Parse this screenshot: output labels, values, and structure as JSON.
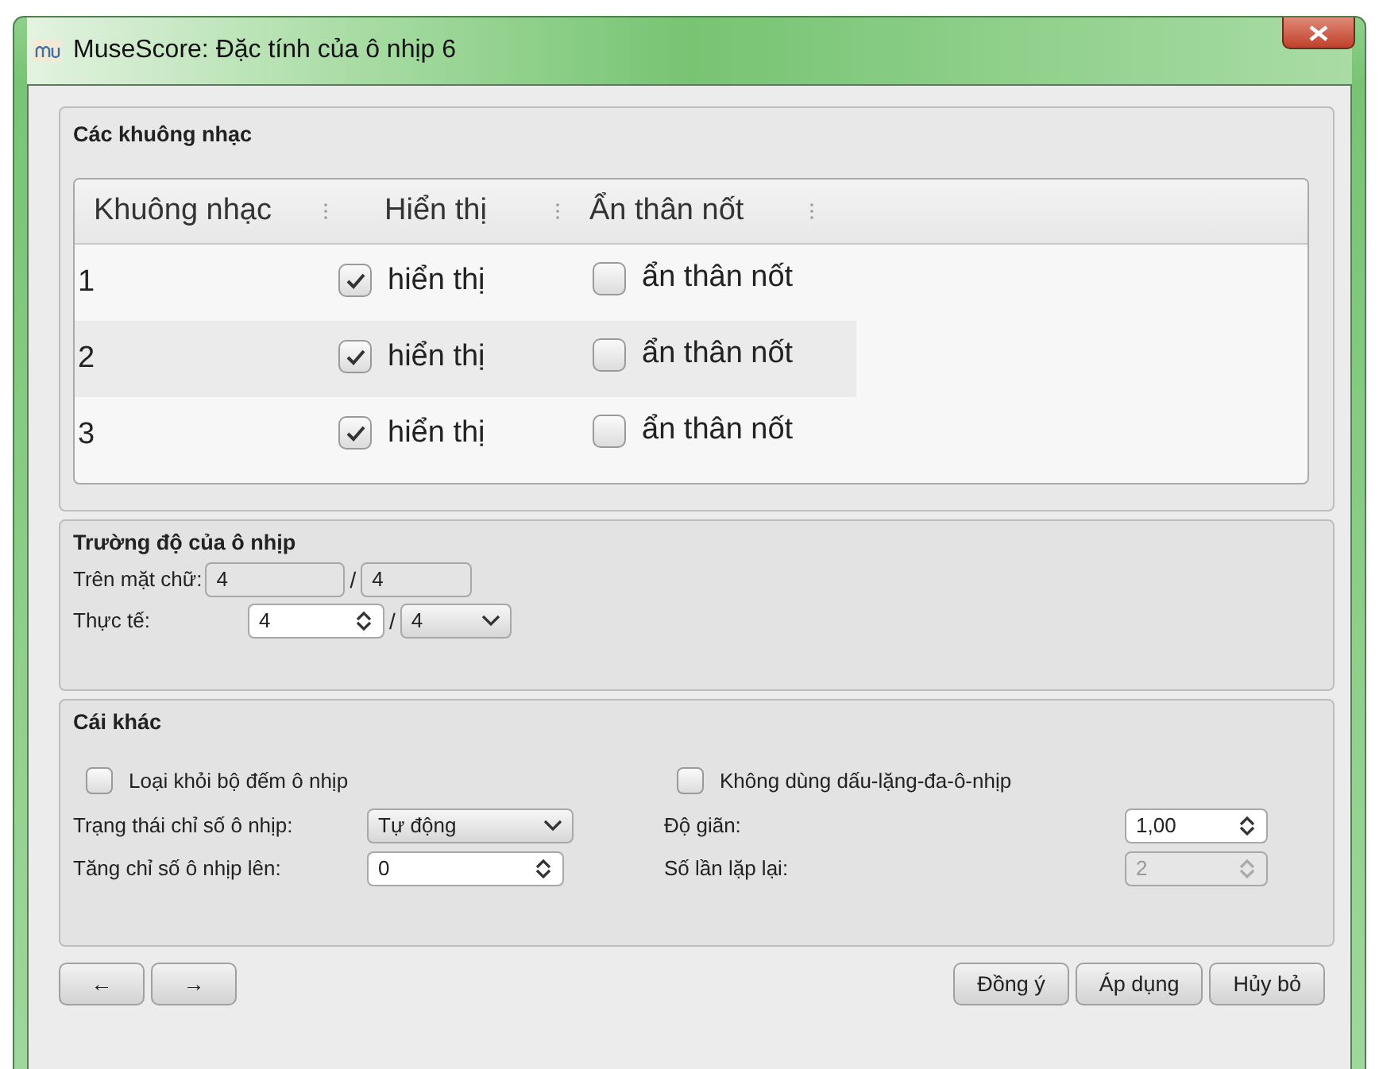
{
  "window": {
    "title": "MuseScore: Đặc tính của ô nhịp 6"
  },
  "staves": {
    "title": "Các khuông nhạc",
    "columns": [
      "Khuông nhạc",
      "Hiển thị",
      "Ẩn thân nốt"
    ],
    "rows": [
      {
        "number": "1",
        "visible": {
          "label": "hiển thị",
          "checked": true
        },
        "hide_stems": {
          "label": "ẩn thân nốt",
          "checked": false
        }
      },
      {
        "number": "2",
        "visible": {
          "label": "hiển thị",
          "checked": true
        },
        "hide_stems": {
          "label": "ẩn thân nốt",
          "checked": false
        }
      },
      {
        "number": "3",
        "visible": {
          "label": "hiển thị",
          "checked": true
        },
        "hide_stems": {
          "label": "ẩn thân nốt",
          "checked": false
        }
      }
    ]
  },
  "duration": {
    "title": "Trường độ của ô nhịp",
    "rows": [
      {
        "label": "Trên mặt chữ:",
        "separator": "/",
        "fields": [
          {
            "kind": "readonly",
            "value": "4"
          },
          {
            "kind": "readonly",
            "value": "4"
          }
        ]
      },
      {
        "label": "Thực tế:",
        "separator": "/",
        "fields": [
          {
            "kind": "spin",
            "value": "4",
            "disabled": false
          },
          {
            "kind": "combo",
            "value": "4"
          }
        ]
      }
    ]
  },
  "other": {
    "title": "Cái khác",
    "columns": [
      {
        "checkbox": {
          "label": "Loại khỏi bộ đếm ô nhịp",
          "checked": false
        },
        "fields": [
          {
            "label": "Trạng thái chỉ số ô nhịp:",
            "kind": "combo",
            "value": "Tự động"
          },
          {
            "label": "Tăng chỉ số ô nhịp lên:",
            "kind": "spin",
            "value": "0",
            "disabled": false
          }
        ]
      },
      {
        "checkbox": {
          "label": "Không dùng dấu-lặng-đa-ô-nhịp",
          "checked": false
        },
        "fields": [
          {
            "label": "Độ giãn:",
            "kind": "spin",
            "value": "1,00",
            "disabled": false
          },
          {
            "label": "Số lần lặp lại:",
            "kind": "spin",
            "value": "2",
            "disabled": true
          }
        ]
      }
    ]
  },
  "nav_buttons": [
    "←",
    "→"
  ],
  "buttons": [
    "Đồng ý",
    "Áp dụng",
    "Hủy bỏ"
  ]
}
